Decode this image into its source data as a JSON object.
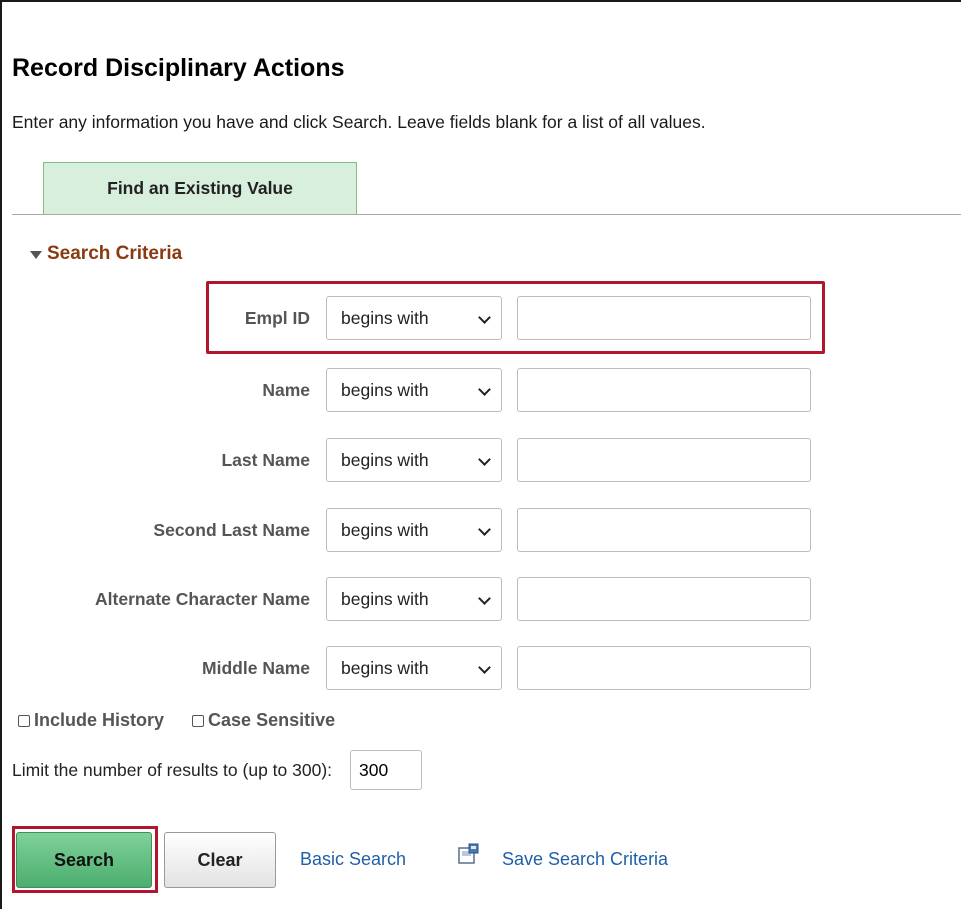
{
  "page": {
    "title": "Record Disciplinary Actions",
    "instructions": "Enter any information you have and click Search. Leave fields blank for a list of all values."
  },
  "tabs": [
    {
      "label": "Find an Existing Value",
      "active": true
    }
  ],
  "search_criteria": {
    "header": "Search Criteria",
    "fields": [
      {
        "label": "Empl ID",
        "operator": "begins with",
        "value": ""
      },
      {
        "label": "Name",
        "operator": "begins with",
        "value": ""
      },
      {
        "label": "Last Name",
        "operator": "begins with",
        "value": ""
      },
      {
        "label": "Second Last Name",
        "operator": "begins with",
        "value": ""
      },
      {
        "label": "Alternate Character Name",
        "operator": "begins with",
        "value": ""
      },
      {
        "label": "Middle Name",
        "operator": "begins with",
        "value": ""
      }
    ],
    "include_history": {
      "label": "Include History",
      "checked": false
    },
    "case_sensitive": {
      "label": "Case Sensitive",
      "checked": false
    },
    "limit": {
      "label": "Limit the number of results to (up to 300):",
      "value": "300"
    }
  },
  "actions": {
    "search": "Search",
    "clear": "Clear",
    "basic_search": "Basic Search",
    "save_search": "Save Search Criteria"
  },
  "colors": {
    "accent_green": "#4cae6e",
    "highlight_red": "#b1162c",
    "link_blue": "#1f5fa8",
    "section_brown": "#8b3a0f"
  },
  "icons": {
    "save_search": "save-search-icon",
    "collapse": "triangle-down-icon"
  }
}
